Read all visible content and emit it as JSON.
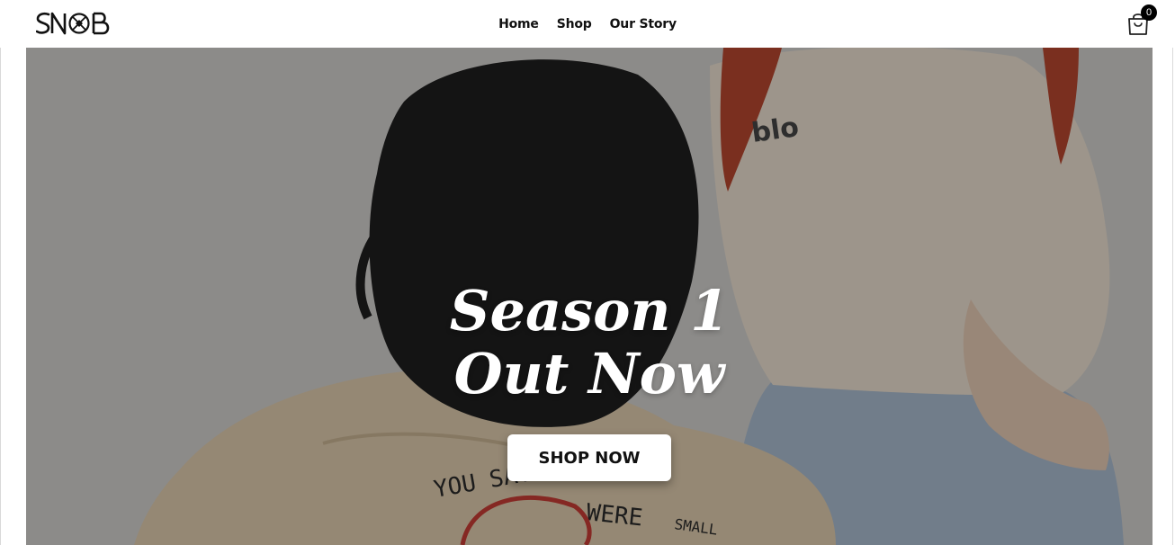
{
  "brand": {
    "logo_text": "SNOB"
  },
  "nav": {
    "items": [
      {
        "label": "Home"
      },
      {
        "label": "Shop"
      },
      {
        "label": "Our Story"
      }
    ]
  },
  "cart": {
    "icon": "shopping-bag-icon",
    "count": "0"
  },
  "hero": {
    "title_line_1": "Season 1",
    "title_line_2": "Out Now",
    "cta_label": "SHOP NOW",
    "image": "two-people-in-beige-tshirts-photo",
    "shirt_print_text": "YOU SAY WE'RE SMALL"
  },
  "colors": {
    "background": "#ffffff",
    "overlay": "rgba(0,0,0,0.32)",
    "text_dark": "#111111",
    "hero_text": "#ffffff",
    "badge": "#000000"
  }
}
